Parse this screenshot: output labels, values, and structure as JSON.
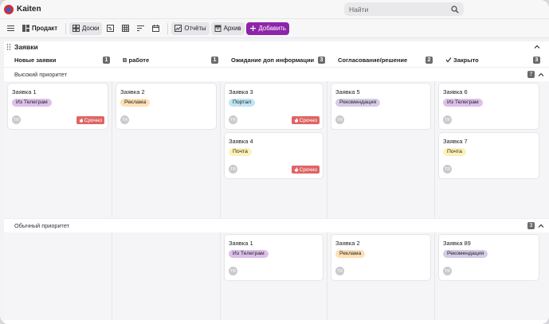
{
  "app": {
    "title": "Kaiten"
  },
  "search": {
    "placeholder": "Найти"
  },
  "toolbar": {
    "space": "Продакт",
    "boards": "Доски",
    "reports": "Отчёты",
    "archive": "Архив",
    "add": "Добавить"
  },
  "board": {
    "title": "Заявки"
  },
  "columns": [
    {
      "name": "Новые заявки",
      "count": "1",
      "width": 136
    },
    {
      "name": "В работе",
      "count": "1",
      "width": 136
    },
    {
      "name": "Ожидание доп информации",
      "count": "3",
      "width": 134
    },
    {
      "name": "Согласование/решение",
      "count": "2",
      "width": 135
    },
    {
      "name": "Закрыто",
      "count": "3",
      "width": 135
    }
  ],
  "colors": {
    "accent": "#8e24aa",
    "urgent": "#e06464",
    "tag_telegram": "#dcc0ea",
    "tag_ads": "#fde0b5",
    "tag_portal": "#bfe5f4",
    "tag_mail": "#fdf1b8",
    "tag_reco": "#d6cbe6"
  },
  "lanes": [
    {
      "name": "Высокий приоритет",
      "count": "7",
      "cols": [
        [
          {
            "title": "Заявка 1",
            "tag": "Из Телеграм",
            "tagColor": "#dcc0ea",
            "avatar": "TR",
            "urgent": "Срочно"
          }
        ],
        [
          {
            "title": "Заявка 2",
            "tag": "Реклама",
            "tagColor": "#fde0b5",
            "avatar": "TR"
          }
        ],
        [
          {
            "title": "Заявка 3",
            "tag": "Портал",
            "tagColor": "#bfe5f4",
            "avatar": "TR",
            "urgent": "Срочно"
          },
          {
            "title": "Заявка 4",
            "tag": "Почта",
            "tagColor": "#fdf1b8",
            "avatar": "TR",
            "urgent": "Срочно"
          }
        ],
        [
          {
            "title": "Заявка 5",
            "tag": "Рекомендация",
            "tagColor": "#d6cbe6",
            "avatar": "TR"
          }
        ],
        [
          {
            "title": "Заявка 6",
            "tag": "Из Телеграм",
            "tagColor": "#dcc0ea",
            "avatar": "TR"
          },
          {
            "title": "Заявка 7",
            "tag": "Почта",
            "tagColor": "#fdf1b8",
            "avatar": "TR"
          }
        ]
      ]
    },
    {
      "name": "Обычный приоритет",
      "count": "3",
      "cols": [
        [],
        [],
        [
          {
            "title": "Заявка 1",
            "tag": "Из Телеграм",
            "tagColor": "#dcc0ea",
            "avatar": "TR"
          }
        ],
        [
          {
            "title": "Заявка 2",
            "tag": "Реклама",
            "tagColor": "#fde0b5",
            "avatar": "TR"
          }
        ],
        [
          {
            "title": "Заявка 89",
            "tag": "Рекомендация",
            "tagColor": "#d6cbe6",
            "avatar": "TR"
          }
        ]
      ]
    }
  ]
}
